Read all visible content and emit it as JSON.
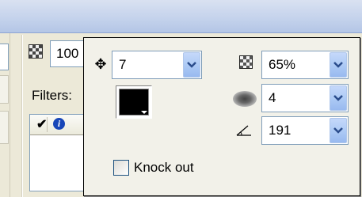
{
  "background_panel": {
    "partial_value": "100",
    "filters_label": "Filters:",
    "filter_list": {
      "columns": [
        "check",
        "info"
      ]
    }
  },
  "dropshadow_popup": {
    "distance": {
      "value": "7",
      "icon": "move-arrows-icon"
    },
    "color": {
      "value": "#000000",
      "icon": "color-swatch"
    },
    "strength": {
      "value": "65%",
      "icon": "checkerboard-icon"
    },
    "blur": {
      "value": "4",
      "icon": "blur-icon"
    },
    "angle": {
      "value": "191",
      "icon": "angle-icon"
    },
    "knockout": {
      "label": "Knock out",
      "checked": false
    }
  },
  "colors": {
    "popup_bg": "#f2f1e9",
    "combo_button": "#aecbf5",
    "field_border": "#7f9db9"
  }
}
